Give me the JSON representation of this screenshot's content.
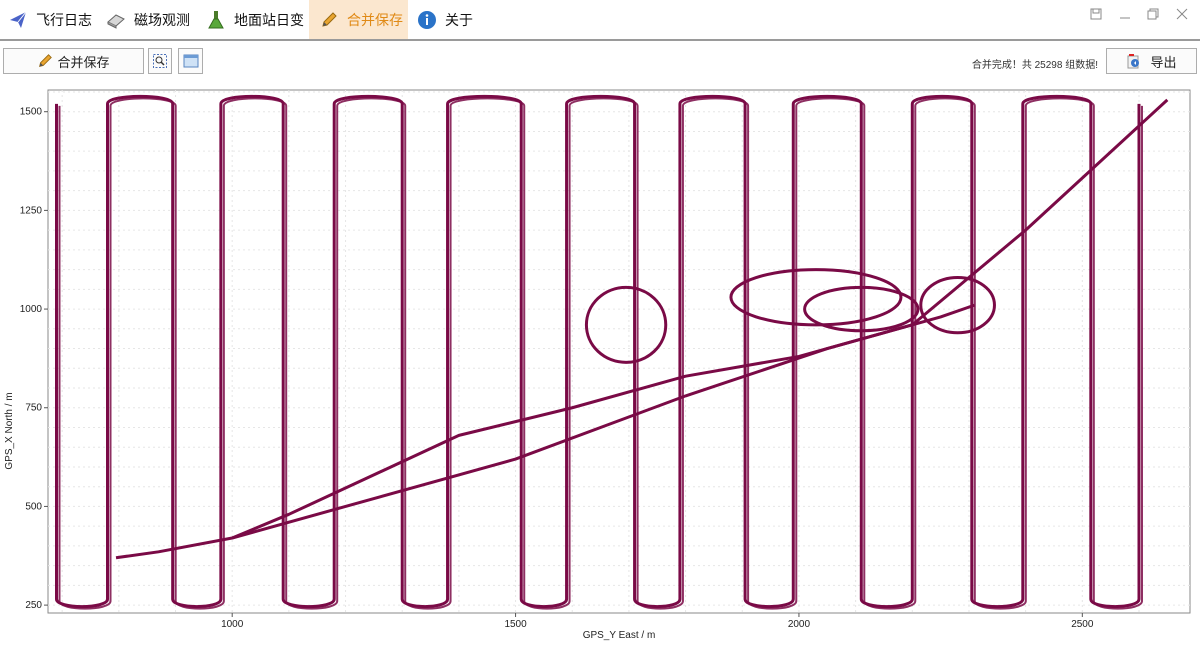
{
  "tabs": [
    {
      "label": "飞行日志",
      "icon": "paper-plane-icon"
    },
    {
      "label": "磁场观测",
      "icon": "eraser-icon"
    },
    {
      "label": "地面站日变",
      "icon": "flask-icon"
    },
    {
      "label": "合并保存",
      "icon": "pencil-icon"
    },
    {
      "label": "关于",
      "icon": "info-icon"
    }
  ],
  "active_tab": "合并保存",
  "toolbar": {
    "merge_save_label": "合并保存",
    "status": "合并完成！共 25298 组数据!",
    "export_label": "导出"
  },
  "colors": {
    "trace": "#7a0a46",
    "accent": "#e08a16",
    "tab_active_bg": "#fbe7cf"
  },
  "chart_data": {
    "type": "scatter",
    "xlabel": "GPS_Y East / m",
    "ylabel": "GPS_X North / m",
    "xlim": [
      675,
      2690
    ],
    "ylim": [
      230,
      1555
    ],
    "xticks": [
      1000,
      1500,
      2000,
      2500
    ],
    "yticks": [
      250,
      500,
      750,
      1000,
      1250,
      1500
    ],
    "grid": true,
    "survey_lines_east_m": [
      690,
      780,
      895,
      980,
      1090,
      1180,
      1300,
      1380,
      1510,
      1590,
      1710,
      1790,
      1905,
      1990,
      2110,
      2200,
      2305,
      2395,
      2515,
      2600
    ],
    "survey_lines_ymin_m": 265,
    "survey_lines_ymax_m": 1520,
    "transit_paths": [
      [
        [
          795,
          370
        ],
        [
          870,
          385
        ],
        [
          1000,
          420
        ],
        [
          1100,
          480
        ],
        [
          1400,
          680
        ],
        [
          1600,
          750
        ],
        [
          1800,
          830
        ],
        [
          2000,
          880
        ],
        [
          2200,
          960
        ],
        [
          2400,
          1200
        ],
        [
          2650,
          1530
        ]
      ],
      [
        [
          1000,
          420
        ],
        [
          1200,
          500
        ],
        [
          1500,
          620
        ],
        [
          1800,
          780
        ],
        [
          2050,
          900
        ],
        [
          2250,
          980
        ],
        [
          2310,
          1010
        ]
      ]
    ],
    "loops": [
      {
        "cx": 1695,
        "cy": 960,
        "rx": 70,
        "ry": 95
      },
      {
        "cx": 2030,
        "cy": 1030,
        "rx": 150,
        "ry": 70
      },
      {
        "cx": 2110,
        "cy": 1000,
        "rx": 100,
        "ry": 55
      },
      {
        "cx": 2280,
        "cy": 1010,
        "rx": 65,
        "ry": 70
      }
    ]
  }
}
